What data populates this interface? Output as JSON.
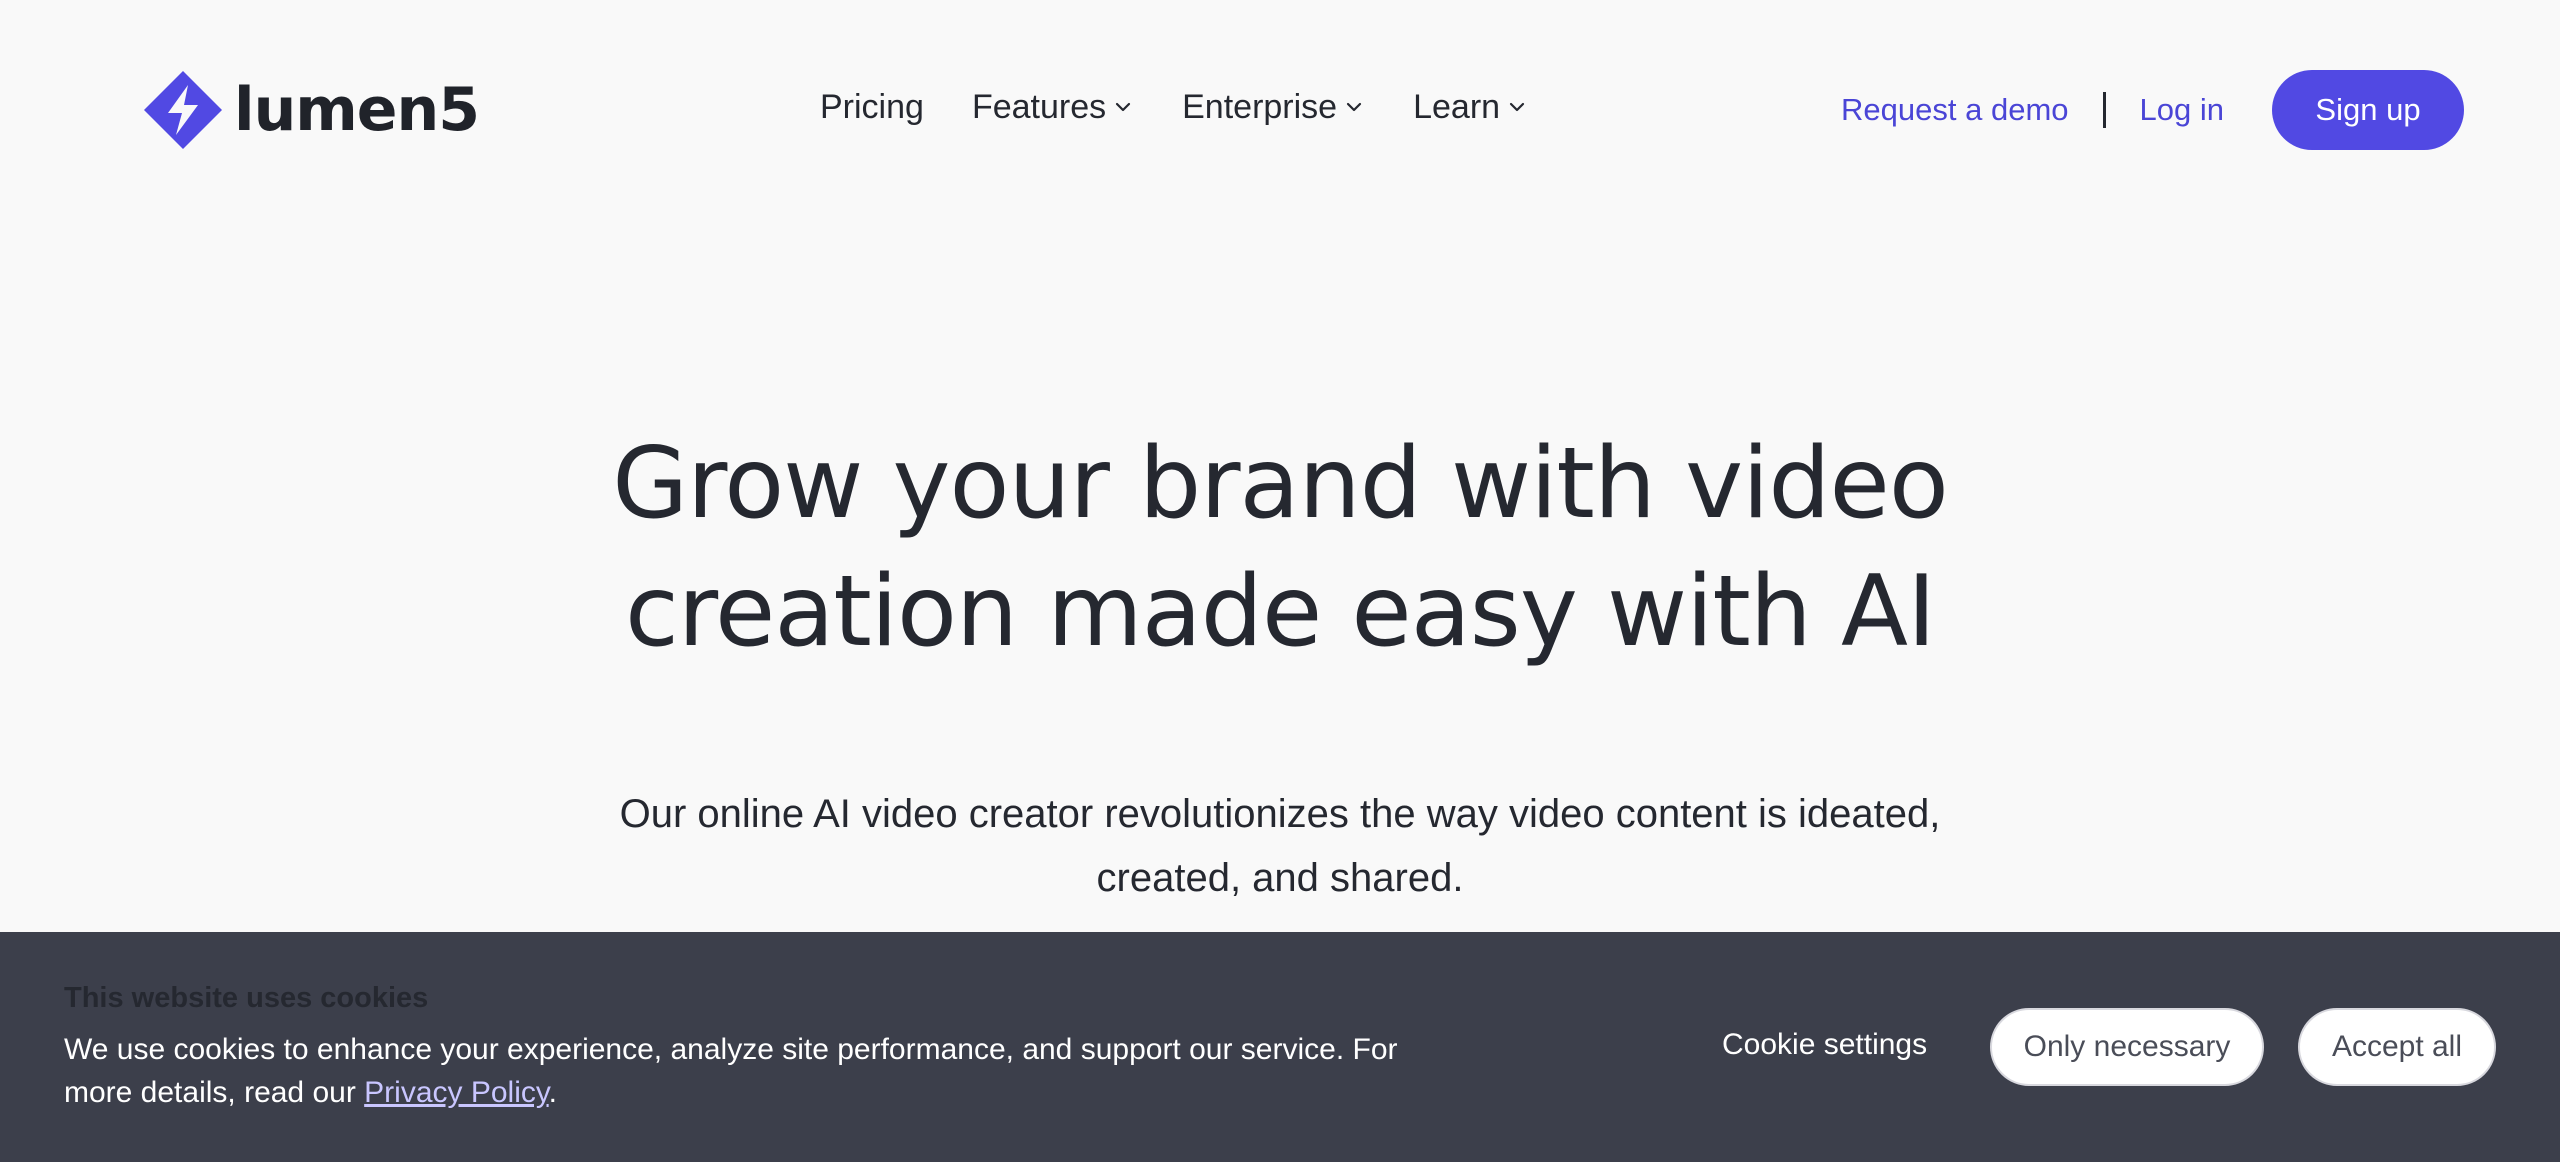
{
  "brand": {
    "name": "lumen5",
    "color": "#5149e3"
  },
  "nav": {
    "items": [
      {
        "label": "Pricing",
        "dropdown": false
      },
      {
        "label": "Features",
        "dropdown": true
      },
      {
        "label": "Enterprise",
        "dropdown": true
      },
      {
        "label": "Learn",
        "dropdown": true
      }
    ]
  },
  "actions": {
    "request_demo": "Request a demo",
    "login": "Log in",
    "signup": "Sign up"
  },
  "hero": {
    "title_line1": "Grow your brand with video",
    "title_line2": "creation made easy with AI",
    "subtitle_line1": "Our online AI video creator revolutionizes the way video content is ideated,",
    "subtitle_line2": "created, and shared."
  },
  "cookie": {
    "title": "This website uses cookies",
    "text_before": "We use cookies to enhance your experience, analyze site performance, and support our service. For more details, read our ",
    "link": "Privacy Policy",
    "text_after": ".",
    "settings": "Cookie settings",
    "only_necessary": "Only necessary",
    "accept_all": "Accept all"
  },
  "colors": {
    "accent": "#5149e3",
    "link": "#4a45d6",
    "banner_bg": "#3c3f4b",
    "page_bg": "#f9f9f9"
  }
}
